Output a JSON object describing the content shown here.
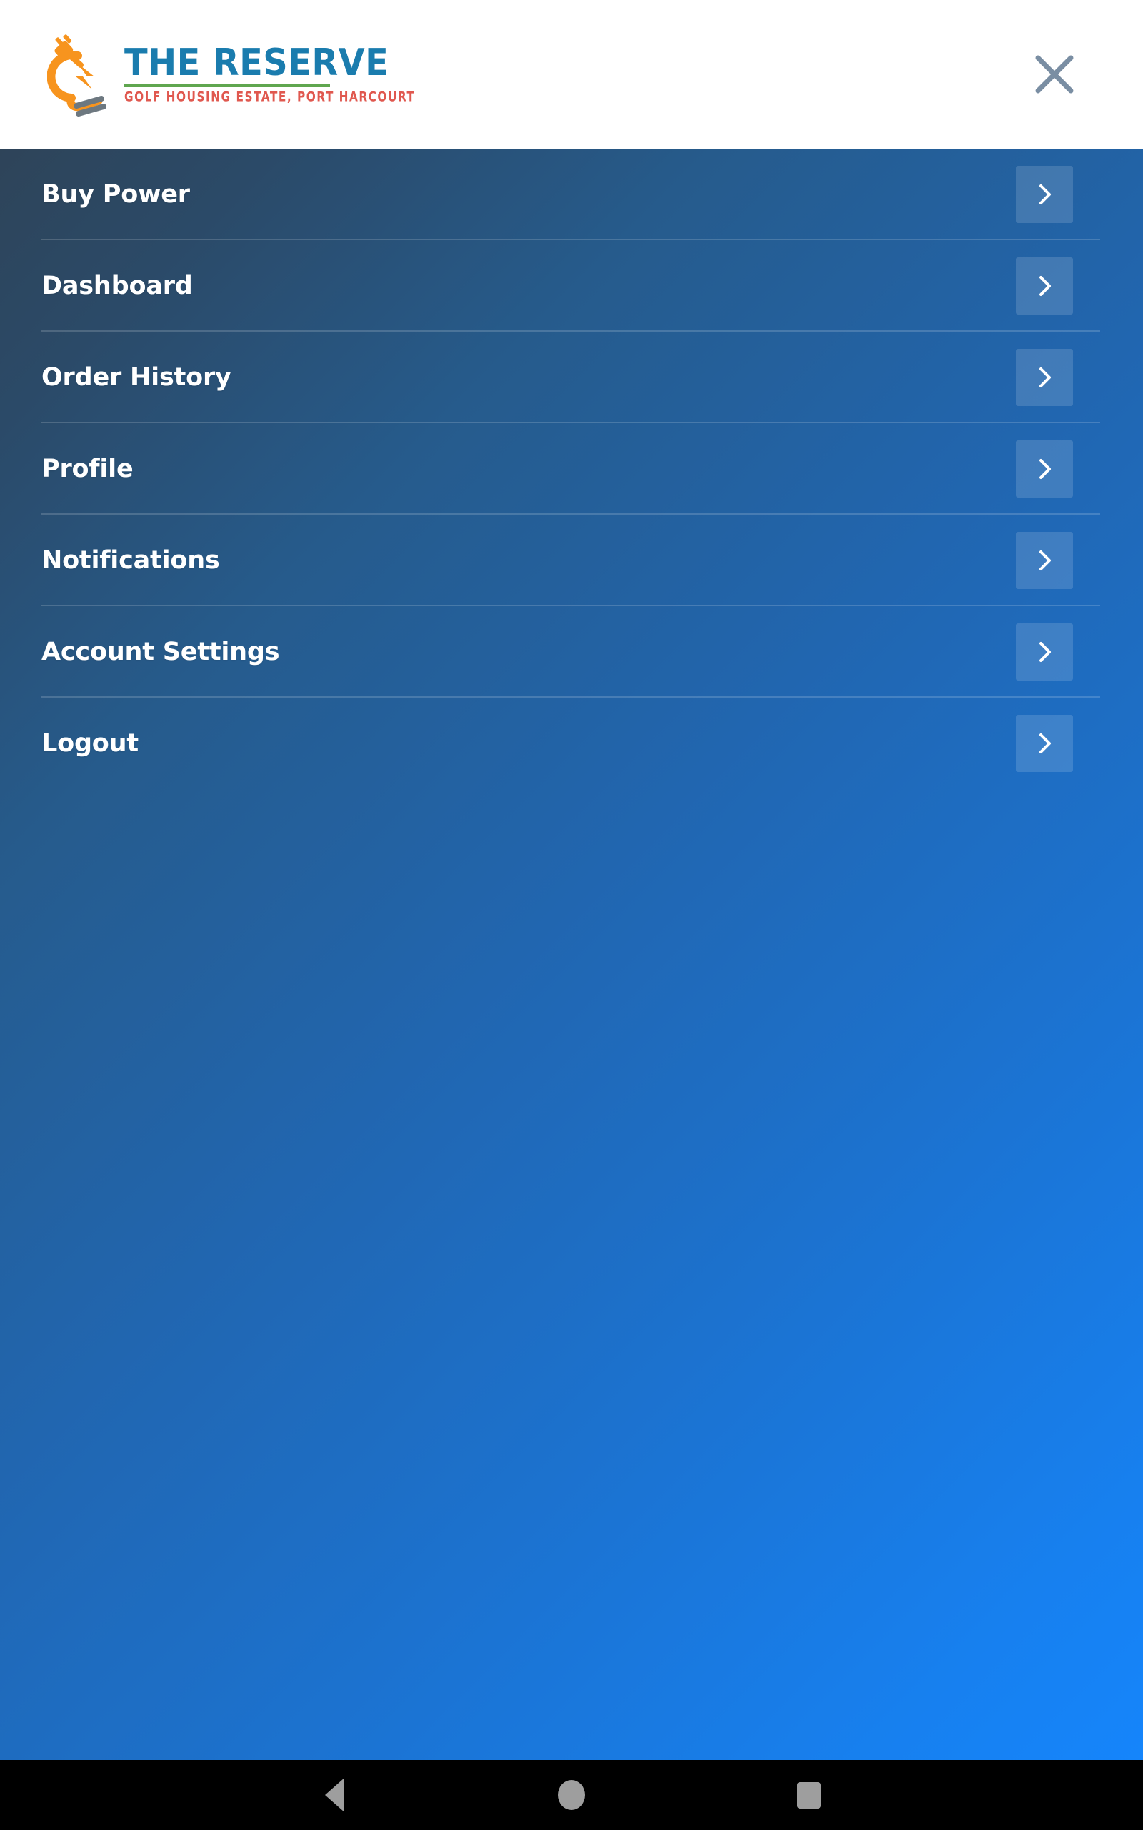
{
  "app": {
    "screen_name": "Side Menu",
    "background_gradient_from": "#2e4459",
    "background_gradient_to": "#1585fb"
  },
  "header": {
    "logo": {
      "icon_name": "reserve-power-plug-bulb-logo",
      "title": "THE RESERVE",
      "title_color": "#1a7cae",
      "rule_color": "#5fa64f",
      "tagline": "GOLF HOUSING ESTATE, PORT HARCOURT",
      "tagline_color": "#e0584f",
      "mark_color": "#f7941e",
      "mark_accent_color": "#6d7880"
    },
    "close": {
      "label": "Close menu",
      "icon_name": "close-icon",
      "color": "#7a8ea3"
    },
    "background": "#ffffff"
  },
  "menu": {
    "items": [
      {
        "label": "Buy Power",
        "chevron": "chevron-right-icon"
      },
      {
        "label": "Dashboard",
        "chevron": "chevron-right-icon"
      },
      {
        "label": "Order History",
        "chevron": "chevron-right-icon"
      },
      {
        "label": "Profile",
        "chevron": "chevron-right-icon"
      },
      {
        "label": "Notifications",
        "chevron": "chevron-right-icon"
      },
      {
        "label": "Account Settings",
        "chevron": "chevron-right-icon"
      },
      {
        "label": "Logout",
        "chevron": "chevron-right-icon"
      }
    ]
  },
  "system_navbar": {
    "background": "#000000",
    "icon_color": "#9e9e9e",
    "buttons": [
      {
        "label": "Back",
        "icon_name": "nav-back-triangle-icon"
      },
      {
        "label": "Home",
        "icon_name": "nav-home-circle-icon"
      },
      {
        "label": "Recents",
        "icon_name": "nav-recents-square-icon"
      }
    ]
  }
}
